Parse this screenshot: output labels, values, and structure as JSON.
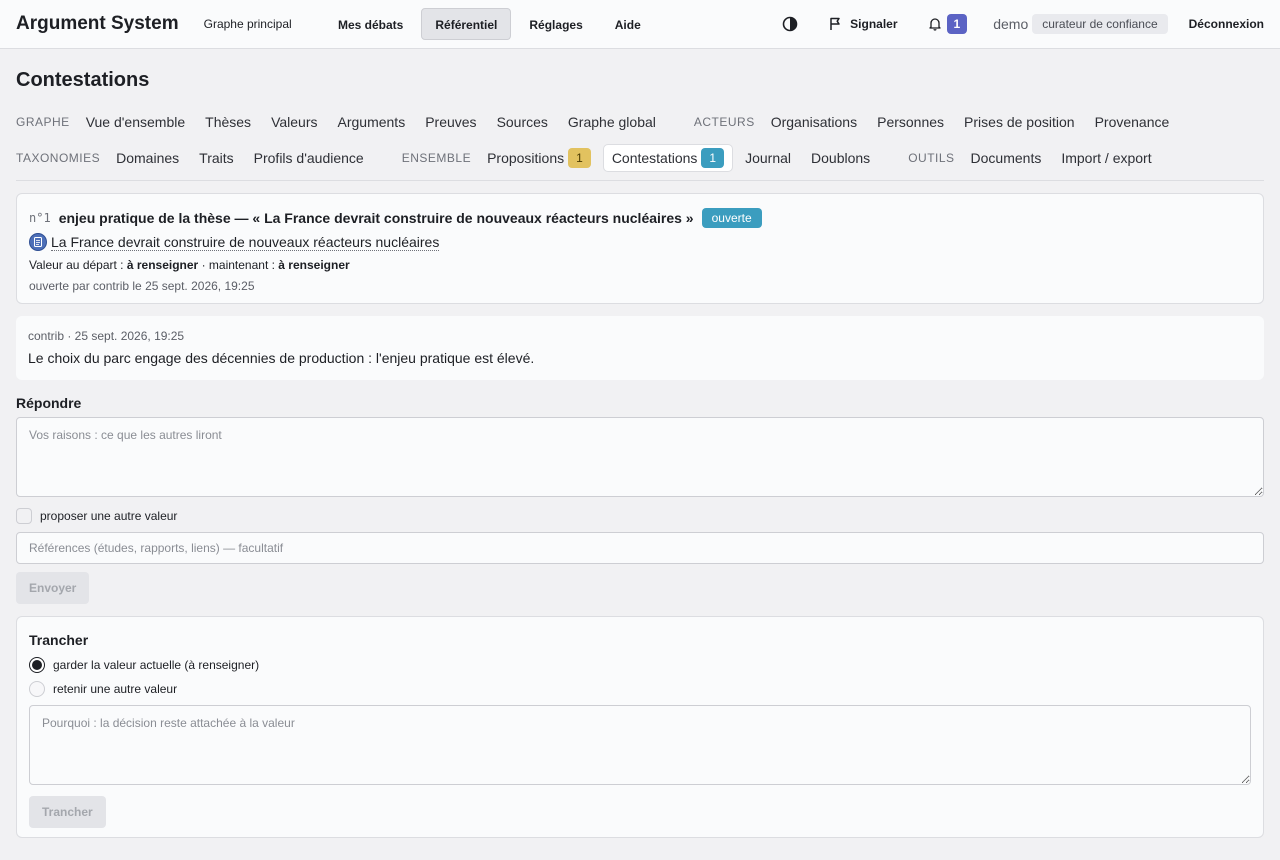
{
  "app": {
    "brand": "Argument System",
    "graph_link": "Graphe principal"
  },
  "mainnav": {
    "items": [
      {
        "label": "Mes débats",
        "active": false
      },
      {
        "label": "Référentiel",
        "active": true
      },
      {
        "label": "Réglages",
        "active": false
      },
      {
        "label": "Aide",
        "active": false
      }
    ]
  },
  "topright": {
    "contrast_icon": "contrast-icon",
    "signal_label": "Signaler",
    "signal_icon": "flag-icon",
    "bell_icon": "bell-icon",
    "notif_count": "1",
    "user": "demo",
    "role": "curateur de confiance",
    "logout": "Déconnexion"
  },
  "page": {
    "title": "Contestations"
  },
  "subnav": {
    "graphe_label": "GRAPHE",
    "graphe": [
      "Vue d'ensemble",
      "Thèses",
      "Valeurs",
      "Arguments",
      "Preuves",
      "Sources",
      "Graphe global"
    ],
    "acteurs_label": "ACTEURS",
    "acteurs": [
      "Organisations",
      "Personnes",
      "Prises de position",
      "Provenance"
    ],
    "taxonomies_label": "TAXONOMIES",
    "taxonomies": [
      "Domaines",
      "Traits",
      "Profils d'audience"
    ],
    "ensemble_label": "ENSEMBLE",
    "propositions": "Propositions",
    "propositions_count": "1",
    "contestations": "Contestations",
    "contestations_count": "1",
    "journal": "Journal",
    "doublons": "Doublons",
    "outils_label": "OUTILS",
    "outils": [
      "Documents",
      "Import / export"
    ]
  },
  "claim": {
    "number": "n°1",
    "title": "enjeu pratique de la thèse — « La France devrait construire de nouveaux réacteurs nucléaires »",
    "status": "ouverte",
    "doc_icon": "document-icon",
    "link_text": "La France devrait construire de nouveaux réacteurs nucléaires",
    "value_start_label": "Valeur au départ :",
    "value_start": "à renseigner",
    "value_now_label": "· maintenant :",
    "value_now": "à renseigner",
    "opened": "ouverte par contrib le 25 sept. 2026, 19:25"
  },
  "comment": {
    "meta": "contrib · 25 sept. 2026, 19:25",
    "text": "Le choix du parc engage des décennies de production : l'enjeu pratique est élevé."
  },
  "reply": {
    "title": "Répondre",
    "placeholder": "Vos raisons : ce que les autres liront",
    "propose_label": "proposer une autre valeur",
    "refs_placeholder": "Références (études, rapports, liens) — facultatif",
    "send": "Envoyer"
  },
  "decide": {
    "title": "Trancher",
    "keep_label": "garder la valeur actuelle (à renseigner)",
    "other_label": "retenir une autre valeur",
    "placeholder": "Pourquoi : la décision reste attachée à la valeur",
    "button": "Trancher"
  }
}
